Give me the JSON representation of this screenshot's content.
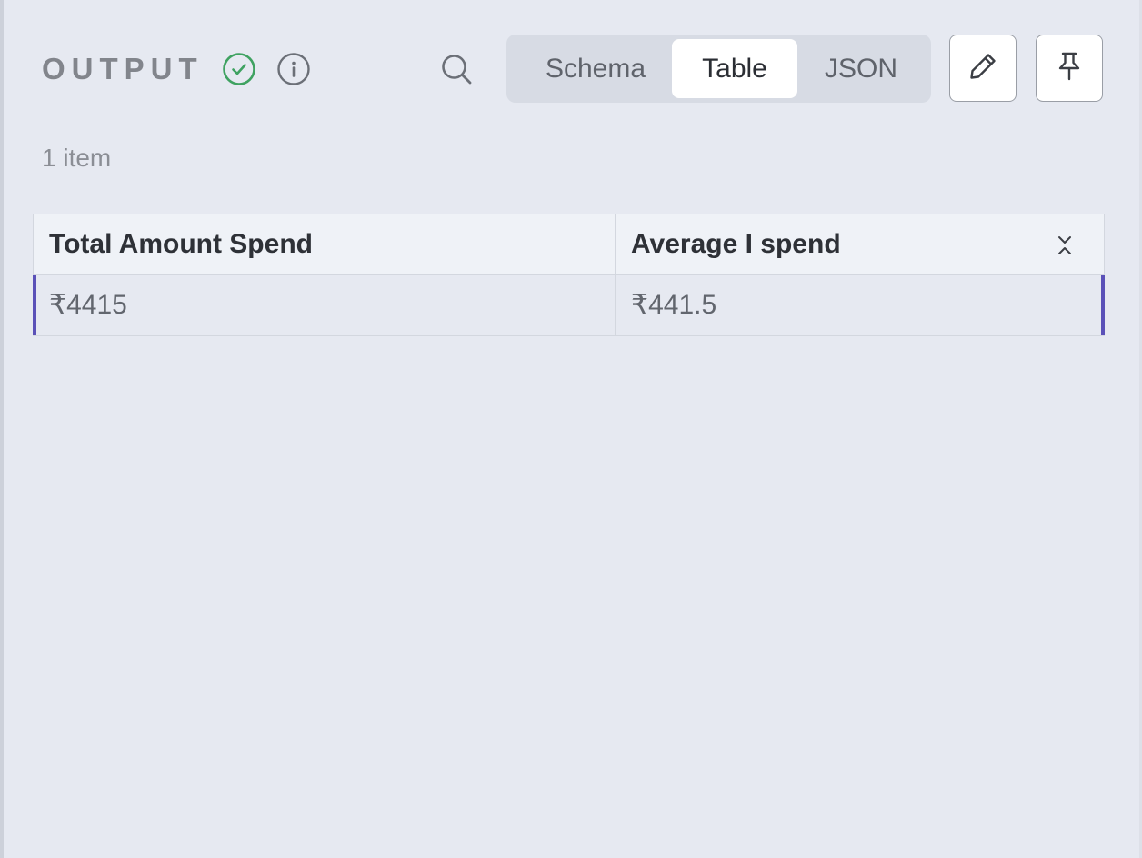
{
  "header": {
    "title": "OUTPUT",
    "status_icon": "check-circle-icon",
    "status_color": "#3fa261",
    "info_icon": "info-icon",
    "search_icon": "search-icon"
  },
  "tabs": [
    {
      "label": "Schema",
      "active": false
    },
    {
      "label": "Table",
      "active": true
    },
    {
      "label": "JSON",
      "active": false
    }
  ],
  "actions": {
    "edit_icon": "pencil-icon",
    "pin_icon": "pin-icon"
  },
  "item_count": "1 item",
  "table": {
    "columns": [
      "Total Amount Spend",
      "Average I spend"
    ],
    "rows": [
      [
        "₹4415",
        "₹441.5"
      ]
    ],
    "selected_row_accent": "#5b51b8",
    "column_toggle_icon": "collapse-icon"
  }
}
